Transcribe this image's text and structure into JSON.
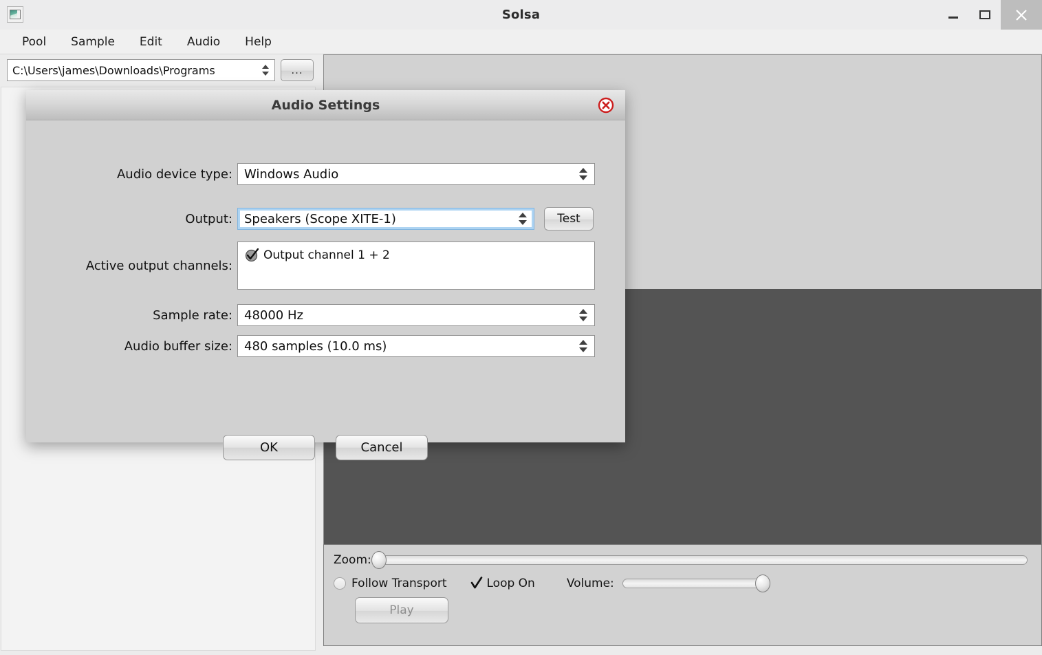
{
  "window": {
    "title": "Solsa",
    "app_icon": "app-window-icon",
    "controls": {
      "minimize": "minimize-icon",
      "maximize": "maximize-icon",
      "close": "close-icon"
    }
  },
  "menubar": {
    "items": [
      {
        "label": "Pool"
      },
      {
        "label": "Sample"
      },
      {
        "label": "Edit"
      },
      {
        "label": "Audio"
      },
      {
        "label": "Help"
      }
    ]
  },
  "browser": {
    "path_value": "C:\\Users\\james\\Downloads\\Programs",
    "browse_button_label": "...",
    "file_list_items": []
  },
  "transport": {
    "zoom_label": "Zoom:",
    "zoom_value": 0,
    "follow_transport_label": "Follow Transport",
    "follow_transport_checked": false,
    "loop_on_label": "Loop On",
    "loop_on_checked": true,
    "volume_label": "Volume:",
    "volume_value": 96,
    "play_label": "Play",
    "play_enabled": false
  },
  "dialog": {
    "title": "Audio Settings",
    "close_icon": "close-circle-icon",
    "fields": {
      "device_type": {
        "label": "Audio device type:",
        "value": "Windows Audio"
      },
      "output": {
        "label": "Output:",
        "value": "Speakers (Scope XITE-1)",
        "focused": true,
        "test_label": "Test"
      },
      "active_channels": {
        "label": "Active output channels:",
        "items": [
          {
            "label": "Output channel 1 + 2",
            "checked": true
          }
        ]
      },
      "sample_rate": {
        "label": "Sample rate:",
        "value": "48000 Hz"
      },
      "buffer_size": {
        "label": "Audio buffer size:",
        "value": "480 samples (10.0 ms)"
      }
    },
    "buttons": {
      "ok": "OK",
      "cancel": "Cancel"
    }
  },
  "colors": {
    "window_bg": "#ececec",
    "dialog_bg": "#d1d1d1",
    "editor_light": "#d2d2d2",
    "editor_dark": "#545454",
    "focus_ring": "#aed4f2",
    "close_red": "#cc1f1f"
  }
}
